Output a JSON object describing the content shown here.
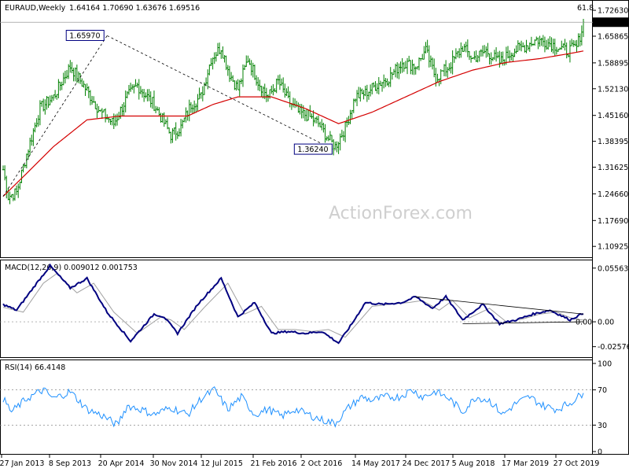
{
  "chart_data": [
    {
      "type": "ohlc",
      "title": "EURAUD,Weekly",
      "ohlc_header": "1.64164 1.70690 1.63676 1.69516",
      "corner_label": "61.8",
      "watermark": "ActionForex.com",
      "ylim": [
        1.085,
        1.745
      ],
      "y_ticks": [
        "1.72630",
        "1.65865",
        "1.58895",
        "1.52130",
        "1.45160",
        "1.38395",
        "1.31625",
        "1.24660",
        "1.17690",
        "1.10925"
      ],
      "last_price": "1.69516",
      "annotations": [
        {
          "label": "1.65970",
          "date_index": 62,
          "value": 1.6597
        },
        {
          "label": "1.36240",
          "date_index": 198,
          "value": 1.3624
        }
      ],
      "price_anchors": [
        [
          0,
          1.31
        ],
        [
          3,
          1.24
        ],
        [
          8,
          1.25
        ],
        [
          14,
          1.35
        ],
        [
          22,
          1.47
        ],
        [
          30,
          1.5
        ],
        [
          40,
          1.58
        ],
        [
          48,
          1.53
        ],
        [
          58,
          1.46
        ],
        [
          66,
          1.43
        ],
        [
          74,
          1.5
        ],
        [
          80,
          1.53
        ],
        [
          90,
          1.48
        ],
        [
          100,
          1.4
        ],
        [
          106,
          1.42
        ],
        [
          112,
          1.48
        ],
        [
          118,
          1.5
        ],
        [
          124,
          1.6
        ],
        [
          130,
          1.63
        ],
        [
          135,
          1.56
        ],
        [
          140,
          1.52
        ],
        [
          146,
          1.6
        ],
        [
          152,
          1.54
        ],
        [
          158,
          1.5
        ],
        [
          164,
          1.54
        ],
        [
          170,
          1.49
        ],
        [
          176,
          1.46
        ],
        [
          182,
          1.45
        ],
        [
          188,
          1.43
        ],
        [
          194,
          1.39
        ],
        [
          198,
          1.37
        ],
        [
          204,
          1.42
        ],
        [
          210,
          1.5
        ],
        [
          216,
          1.51
        ],
        [
          222,
          1.53
        ],
        [
          230,
          1.55
        ],
        [
          238,
          1.59
        ],
        [
          246,
          1.58
        ],
        [
          252,
          1.62
        ],
        [
          258,
          1.55
        ],
        [
          266,
          1.58
        ],
        [
          274,
          1.63
        ],
        [
          280,
          1.6
        ],
        [
          288,
          1.62
        ],
        [
          296,
          1.59
        ],
        [
          304,
          1.62
        ],
        [
          310,
          1.63
        ],
        [
          318,
          1.65
        ],
        [
          326,
          1.64
        ],
        [
          336,
          1.62
        ],
        [
          342,
          1.63
        ],
        [
          346,
          1.69
        ]
      ],
      "ma_anchors": [
        [
          0,
          1.24
        ],
        [
          14,
          1.3
        ],
        [
          30,
          1.37
        ],
        [
          50,
          1.44
        ],
        [
          70,
          1.45
        ],
        [
          90,
          1.45
        ],
        [
          110,
          1.45
        ],
        [
          125,
          1.48
        ],
        [
          140,
          1.5
        ],
        [
          160,
          1.5
        ],
        [
          180,
          1.47
        ],
        [
          200,
          1.43
        ],
        [
          220,
          1.46
        ],
        [
          240,
          1.5
        ],
        [
          260,
          1.54
        ],
        [
          280,
          1.57
        ],
        [
          300,
          1.59
        ],
        [
          320,
          1.6
        ],
        [
          340,
          1.615
        ],
        [
          346,
          1.62
        ]
      ],
      "trend_lines": [
        [
          [
            0,
            1.24
          ],
          [
            62,
            1.66
          ]
        ],
        [
          [
            62,
            1.66
          ],
          [
            198,
            1.36
          ]
        ]
      ]
    },
    {
      "type": "line",
      "title": "MACD(12,26,9) 0.009012 0.001753",
      "ylim": [
        -0.035,
        0.062
      ],
      "y_ticks": [
        "0.055637",
        "0.00",
        "-0.02576"
      ],
      "zero_label": "0.00",
      "series": [
        {
          "anchors": [
            [
              0,
              0.018
            ],
            [
              8,
              0.012
            ],
            [
              20,
              0.04
            ],
            [
              28,
              0.058
            ],
            [
              40,
              0.035
            ],
            [
              50,
              0.045
            ],
            [
              62,
              0.01
            ],
            [
              76,
              -0.02
            ],
            [
              90,
              0.008
            ],
            [
              96,
              0.005
            ],
            [
              104,
              -0.012
            ],
            [
              116,
              0.018
            ],
            [
              130,
              0.045
            ],
            [
              140,
              0.005
            ],
            [
              150,
              0.02
            ],
            [
              160,
              -0.012
            ],
            [
              170,
              -0.01
            ],
            [
              180,
              -0.012
            ],
            [
              190,
              -0.01
            ],
            [
              200,
              -0.022
            ],
            [
              208,
              -0.002
            ],
            [
              216,
              0.02
            ],
            [
              226,
              0.018
            ],
            [
              238,
              0.02
            ],
            [
              246,
              0.026
            ],
            [
              256,
              0.014
            ],
            [
              264,
              0.026
            ],
            [
              274,
              0.002
            ],
            [
              286,
              0.018
            ],
            [
              296,
              -0.002
            ],
            [
              306,
              0.002
            ],
            [
              316,
              0.008
            ],
            [
              326,
              0.012
            ],
            [
              338,
              0.002
            ],
            [
              346,
              0.009
            ]
          ]
        },
        {
          "anchors": [
            [
              0,
              0.015
            ],
            [
              12,
              0.01
            ],
            [
              24,
              0.04
            ],
            [
              32,
              0.05
            ],
            [
              44,
              0.03
            ],
            [
              54,
              0.04
            ],
            [
              66,
              0.01
            ],
            [
              80,
              -0.012
            ],
            [
              94,
              0.005
            ],
            [
              100,
              0.002
            ],
            [
              108,
              -0.008
            ],
            [
              120,
              0.015
            ],
            [
              134,
              0.04
            ],
            [
              144,
              0.008
            ],
            [
              154,
              0.016
            ],
            [
              164,
              -0.008
            ],
            [
              174,
              -0.008
            ],
            [
              184,
              -0.01
            ],
            [
              194,
              -0.008
            ],
            [
              204,
              -0.016
            ],
            [
              212,
              0.0
            ],
            [
              220,
              0.016
            ],
            [
              230,
              0.018
            ],
            [
              242,
              0.02
            ],
            [
              250,
              0.022
            ],
            [
              260,
              0.012
            ],
            [
              268,
              0.022
            ],
            [
              278,
              0.004
            ],
            [
              290,
              0.014
            ],
            [
              300,
              0.0
            ],
            [
              310,
              0.003
            ],
            [
              320,
              0.008
            ],
            [
              330,
              0.01
            ],
            [
              340,
              0.003
            ],
            [
              346,
              0.0018
            ]
          ]
        }
      ],
      "trend_lines": [
        [
          [
            246,
            0.026
          ],
          [
            346,
            0.008
          ]
        ],
        [
          [
            274,
            -0.002
          ],
          [
            346,
            0.0
          ]
        ]
      ]
    },
    {
      "type": "line",
      "title": "RSI(14) 66.4148",
      "ylim": [
        0,
        100
      ],
      "y_ticks": [
        "100",
        "70",
        "30",
        "0"
      ],
      "levels": [
        70,
        30
      ],
      "series": [
        {
          "anchors": [
            [
              0,
              60
            ],
            [
              5,
              45
            ],
            [
              14,
              60
            ],
            [
              24,
              70
            ],
            [
              30,
              60
            ],
            [
              40,
              68
            ],
            [
              50,
              48
            ],
            [
              60,
              40
            ],
            [
              68,
              30
            ],
            [
              74,
              52
            ],
            [
              82,
              48
            ],
            [
              90,
              42
            ],
            [
              100,
              50
            ],
            [
              110,
              42
            ],
            [
              118,
              60
            ],
            [
              126,
              70
            ],
            [
              134,
              48
            ],
            [
              142,
              62
            ],
            [
              150,
              42
            ],
            [
              158,
              48
            ],
            [
              166,
              40
            ],
            [
              174,
              48
            ],
            [
              182,
              42
            ],
            [
              190,
              36
            ],
            [
              198,
              32
            ],
            [
              206,
              50
            ],
            [
              214,
              62
            ],
            [
              220,
              58
            ],
            [
              228,
              62
            ],
            [
              236,
              62
            ],
            [
              244,
              70
            ],
            [
              250,
              62
            ],
            [
              258,
              68
            ],
            [
              266,
              60
            ],
            [
              274,
              45
            ],
            [
              282,
              62
            ],
            [
              290,
              58
            ],
            [
              298,
              42
            ],
            [
              306,
              55
            ],
            [
              314,
              62
            ],
            [
              322,
              52
            ],
            [
              330,
              48
            ],
            [
              338,
              55
            ],
            [
              346,
              66.4
            ]
          ]
        }
      ]
    }
  ],
  "x_ticks": [
    "27 Jan 2013",
    "8 Sep 2013",
    "20 Apr 2014",
    "30 Nov 2014",
    "12 Jul 2015",
    "21 Feb 2016",
    "2 Oct 2016",
    "14 May 2017",
    "24 Dec 2017",
    "5 Aug 2018",
    "17 Mar 2019",
    "27 Oct 2019"
  ],
  "colors": {
    "price": "#008000",
    "ma": "#d40000",
    "macd": "#000080",
    "signal": "#a0a0a0",
    "rsi": "#1e90ff",
    "annotation": "#000080"
  }
}
